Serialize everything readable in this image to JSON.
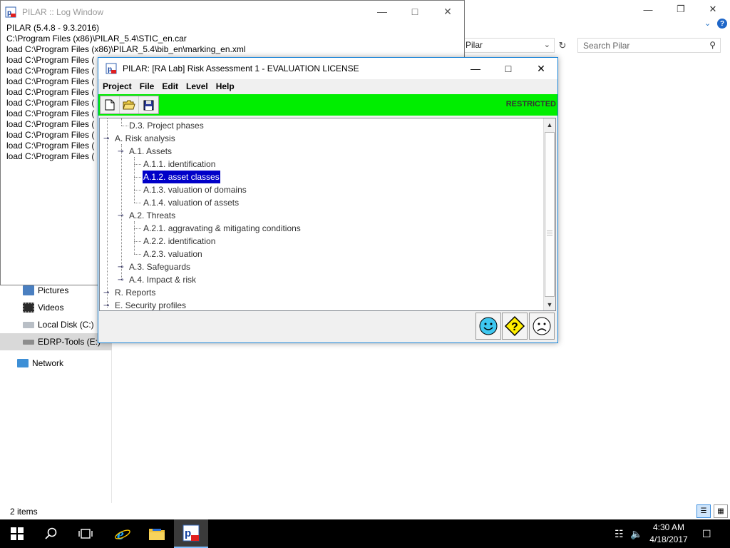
{
  "explorer": {
    "nav_select_value": "Pilar",
    "search_placeholder": "Search Pilar",
    "help_char": "?",
    "nav_items": [
      {
        "label": "Pictures",
        "icon": "pictures-folder-icon"
      },
      {
        "label": "Videos",
        "icon": "videos-folder-icon"
      },
      {
        "label": "Local Disk (C:)",
        "icon": "drive-icon"
      },
      {
        "label": "EDRP-Tools (E:)",
        "icon": "usb-drive-icon"
      },
      {
        "label": "Network",
        "icon": "network-icon"
      }
    ],
    "status": "2 items"
  },
  "log_window": {
    "title": "PILAR :: Log Window",
    "lines": [
      "PILAR (5.4.8 - 9.3.2016)",
      "C:\\Program Files (x86)\\PILAR_5.4\\STIC_en.car",
      "load C:\\Program Files (x86)\\PILAR_5.4\\bib_en\\marking_en.xml",
      "load C:\\Program Files (",
      "load C:\\Program Files (",
      "load C:\\Program Files (",
      "load C:\\Program Files (",
      "load C:\\Program Files (",
      "load C:\\Program Files (",
      "load C:\\Program Files (",
      "load C:\\Program Files (",
      "load C:\\Program Files (",
      "load C:\\Program Files ("
    ]
  },
  "main_window": {
    "title": "PILAR: [RA Lab] Risk Assessment 1 - EVALUATION LICENSE",
    "menu": [
      "Project",
      "File",
      "Edit",
      "Level",
      "Help"
    ],
    "toolbar": {
      "restricted_label": "RESTRICTED",
      "buttons": [
        "new-file-icon",
        "open-folder-icon",
        "save-disk-icon"
      ]
    },
    "tree": [
      {
        "label": "D.3. Project phases",
        "selected": false
      },
      {
        "label": "A. Risk analysis",
        "selected": false
      },
      {
        "label": "A.1. Assets",
        "selected": false
      },
      {
        "label": "A.1.1. identification",
        "selected": false
      },
      {
        "label": "A.1.2. asset classes",
        "selected": true
      },
      {
        "label": "A.1.3. valuation of domains",
        "selected": false
      },
      {
        "label": "A.1.4. valuation of assets",
        "selected": false
      },
      {
        "label": "A.2. Threats",
        "selected": false
      },
      {
        "label": "A.2.1. aggravating & mitigating conditions",
        "selected": false
      },
      {
        "label": "A.2.2. identification",
        "selected": false
      },
      {
        "label": "A.2.3. valuation",
        "selected": false
      },
      {
        "label": "A.3. Safeguards",
        "selected": false
      },
      {
        "label": "A.4. Impact & risk",
        "selected": false
      },
      {
        "label": "R. Reports",
        "selected": false
      },
      {
        "label": "E. Security profiles",
        "selected": false
      }
    ],
    "face_buttons": [
      "happy-face-icon",
      "question-diamond-icon",
      "sad-face-icon"
    ]
  },
  "taskbar": {
    "time": "4:30 AM",
    "date": "4/18/2017",
    "colors": {
      "background": "#000000",
      "toolbar_green": "#00ee00",
      "selection_blue": "#0000c8"
    }
  }
}
